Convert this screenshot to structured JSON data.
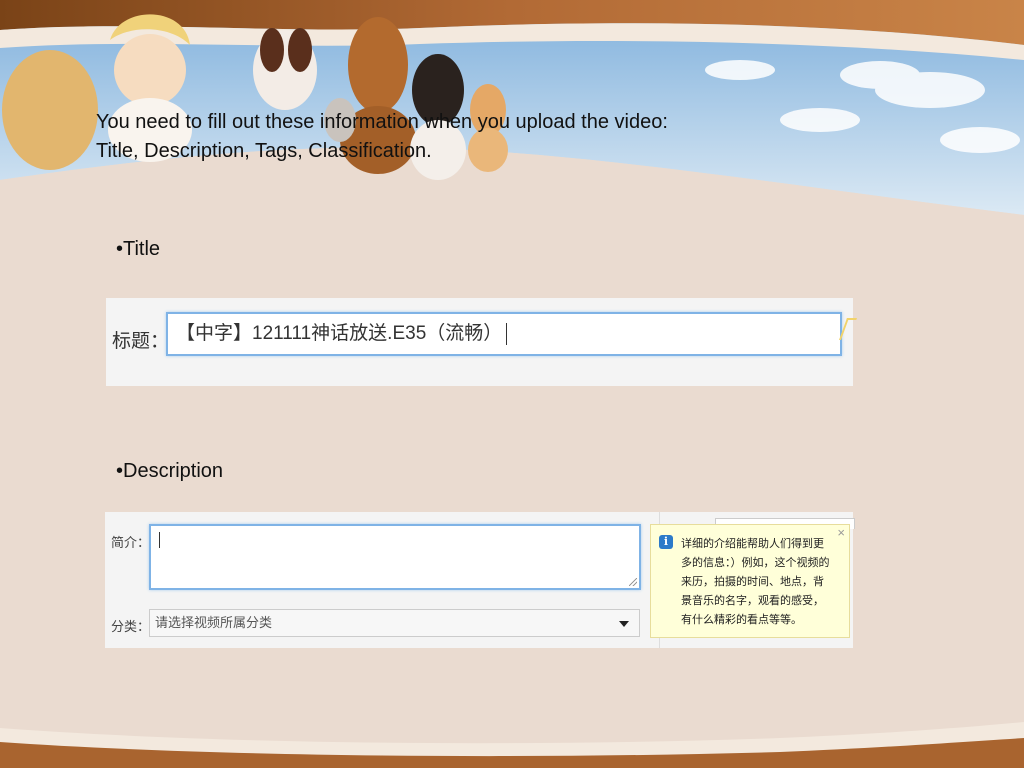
{
  "slide": {
    "intro_line1": "You need to fill out these information when you upload the video:",
    "intro_line2": "Title, Description, Tags, Classification.",
    "bullet_title": "•Title",
    "bullet_description": "•Description"
  },
  "title_form": {
    "label": "标题：",
    "value": "【中字】121111神话放送.E35（流畅）"
  },
  "description_form": {
    "intro_label": "简介：",
    "intro_value": "",
    "category_label": "分类：",
    "category_placeholder": "请选择视频所属分类",
    "tooltip_text": "详细的介绍能帮助人们得到更多的信息：）例如，这个视频的来历，拍摄的时间、地点，背景音乐的名字，观看的感受，有什么精彩的看点等等。",
    "tooltip_close": "×",
    "info_glyph": "i"
  },
  "icons": {
    "info": "info-icon",
    "close": "close-icon",
    "dropdown": "chevron-down-icon",
    "resize": "resize-grip-icon"
  },
  "colors": {
    "background": "#eadbd0",
    "banner_brown": "#9b5a2a",
    "sky": "#a9cdeb",
    "input_focus_border": "#7fb3e6",
    "tooltip_bg": "#ffffd9"
  }
}
